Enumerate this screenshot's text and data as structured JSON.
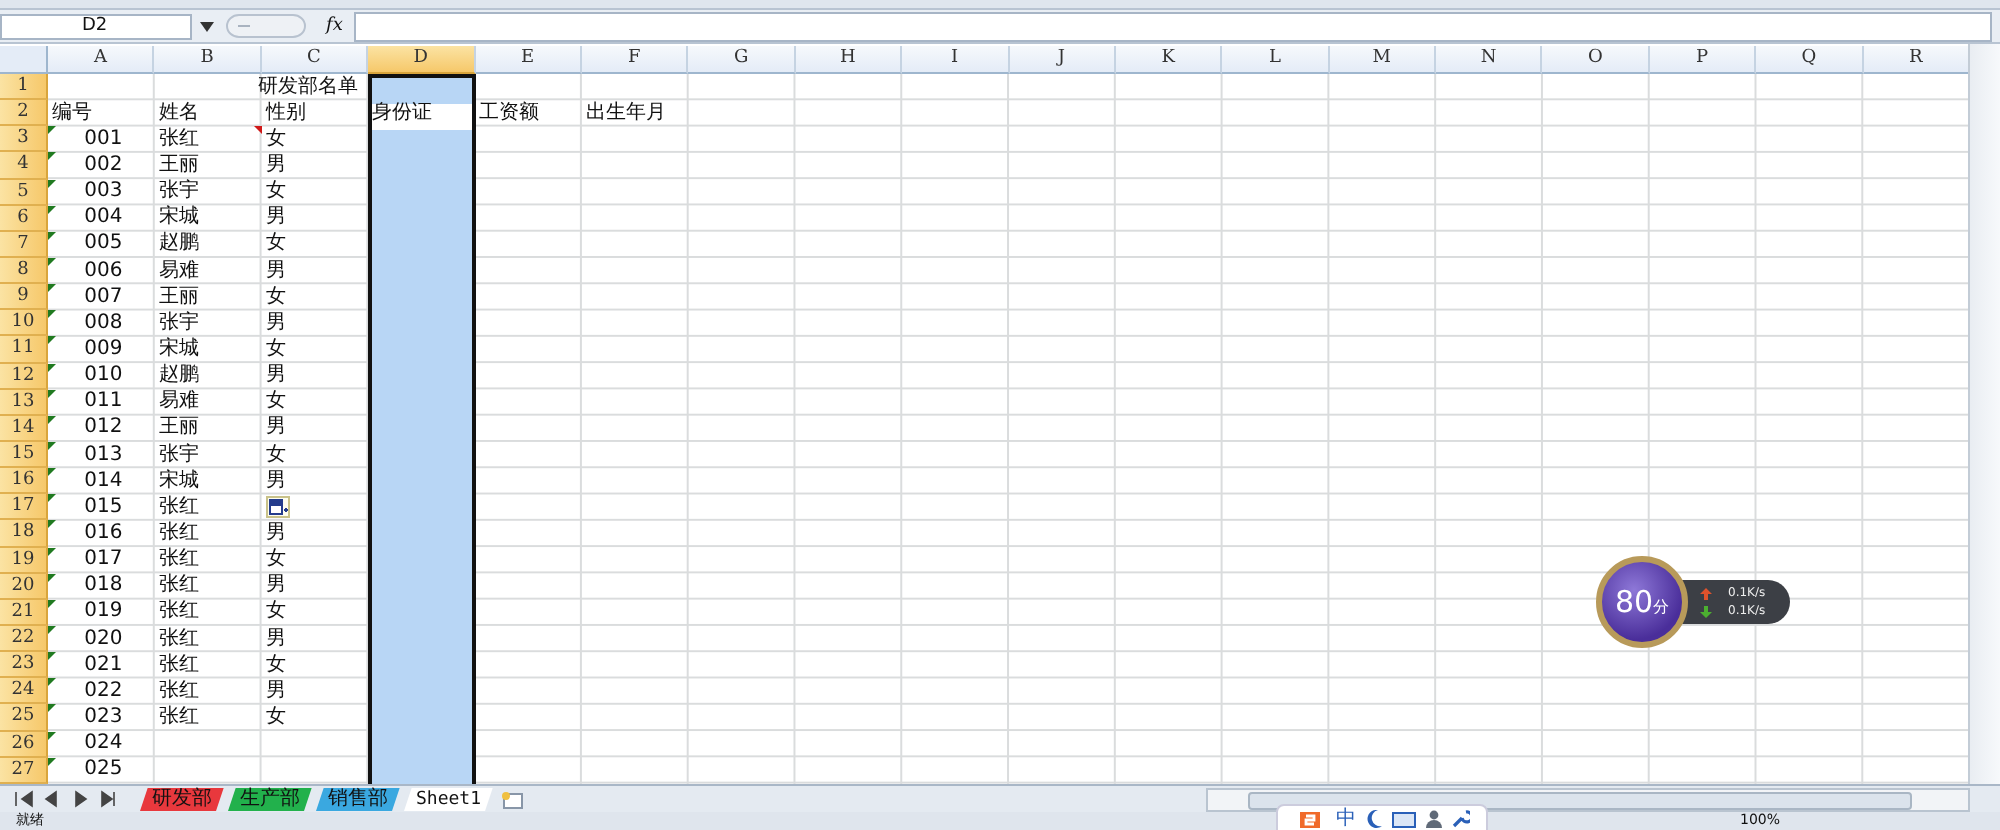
{
  "name_box": "D2",
  "formula_label": "fx",
  "columns": [
    {
      "label": "A",
      "selected": false
    },
    {
      "label": "B",
      "selected": false
    },
    {
      "label": "C",
      "selected": false
    },
    {
      "label": "D",
      "selected": true
    },
    {
      "label": "E",
      "selected": false
    },
    {
      "label": "F",
      "selected": false
    },
    {
      "label": "G",
      "selected": false
    },
    {
      "label": "H",
      "selected": false
    },
    {
      "label": "I",
      "selected": false
    },
    {
      "label": "J",
      "selected": false
    },
    {
      "label": "K",
      "selected": false
    },
    {
      "label": "L",
      "selected": false
    },
    {
      "label": "M",
      "selected": false
    },
    {
      "label": "N",
      "selected": false
    },
    {
      "label": "O",
      "selected": false
    },
    {
      "label": "P",
      "selected": false
    },
    {
      "label": "Q",
      "selected": false
    },
    {
      "label": "R",
      "selected": false
    }
  ],
  "title_row": {
    "row": "1",
    "text": "研发部名单"
  },
  "header_row": {
    "row": "2",
    "cells": [
      "编号",
      "姓名",
      "性别",
      "身份证",
      "工资额",
      "出生年月"
    ]
  },
  "rows": [
    {
      "row": "3",
      "number": "001",
      "name": "张红",
      "gender": "女",
      "comment": true
    },
    {
      "row": "4",
      "number": "002",
      "name": "王丽",
      "gender": "男"
    },
    {
      "row": "5",
      "number": "003",
      "name": "张宇",
      "gender": "女"
    },
    {
      "row": "6",
      "number": "004",
      "name": "宋城",
      "gender": "男"
    },
    {
      "row": "7",
      "number": "005",
      "name": "赵鹏",
      "gender": "女"
    },
    {
      "row": "8",
      "number": "006",
      "name": "易难",
      "gender": "男"
    },
    {
      "row": "9",
      "number": "007",
      "name": "王丽",
      "gender": "女"
    },
    {
      "row": "10",
      "number": "008",
      "name": "张宇",
      "gender": "男"
    },
    {
      "row": "11",
      "number": "009",
      "name": "宋城",
      "gender": "女"
    },
    {
      "row": "12",
      "number": "010",
      "name": "赵鹏",
      "gender": "男"
    },
    {
      "row": "13",
      "number": "011",
      "name": "易难",
      "gender": "女"
    },
    {
      "row": "14",
      "number": "012",
      "name": "王丽",
      "gender": "男"
    },
    {
      "row": "15",
      "number": "013",
      "name": "张宇",
      "gender": "女"
    },
    {
      "row": "16",
      "number": "014",
      "name": "宋城",
      "gender": "男"
    },
    {
      "row": "17",
      "number": "015",
      "name": "张红",
      "paste_options": true
    },
    {
      "row": "18",
      "number": "016",
      "name": "张红",
      "gender": "男"
    },
    {
      "row": "19",
      "number": "017",
      "name": "张红",
      "gender": "女"
    },
    {
      "row": "20",
      "number": "018",
      "name": "张红",
      "gender": "男"
    },
    {
      "row": "21",
      "number": "019",
      "name": "张红",
      "gender": "女"
    },
    {
      "row": "22",
      "number": "020",
      "name": "张红",
      "gender": "男"
    },
    {
      "row": "23",
      "number": "021",
      "name": "张红",
      "gender": "女"
    },
    {
      "row": "24",
      "number": "022",
      "name": "张红",
      "gender": "男"
    },
    {
      "row": "25",
      "number": "023",
      "name": "张红",
      "gender": "女"
    },
    {
      "row": "26",
      "number": "024"
    },
    {
      "row": "27",
      "number": "025"
    }
  ],
  "sheet_tabs": [
    {
      "label": "研发部",
      "color": "#e8383d",
      "selected": false
    },
    {
      "label": "生产部",
      "color": "#22b14c",
      "selected": false
    },
    {
      "label": "销售部",
      "color": "#3aa8e0",
      "selected": false
    },
    {
      "label": "Sheet1",
      "selected": true
    }
  ],
  "status_bar": {
    "text": "就绪",
    "zoom": "100%"
  },
  "speed_widget": {
    "score": "80",
    "unit": "分",
    "upload": "0.1K/s",
    "download": "0.1K/s"
  },
  "ime_toolbar": {
    "mode": "中"
  }
}
